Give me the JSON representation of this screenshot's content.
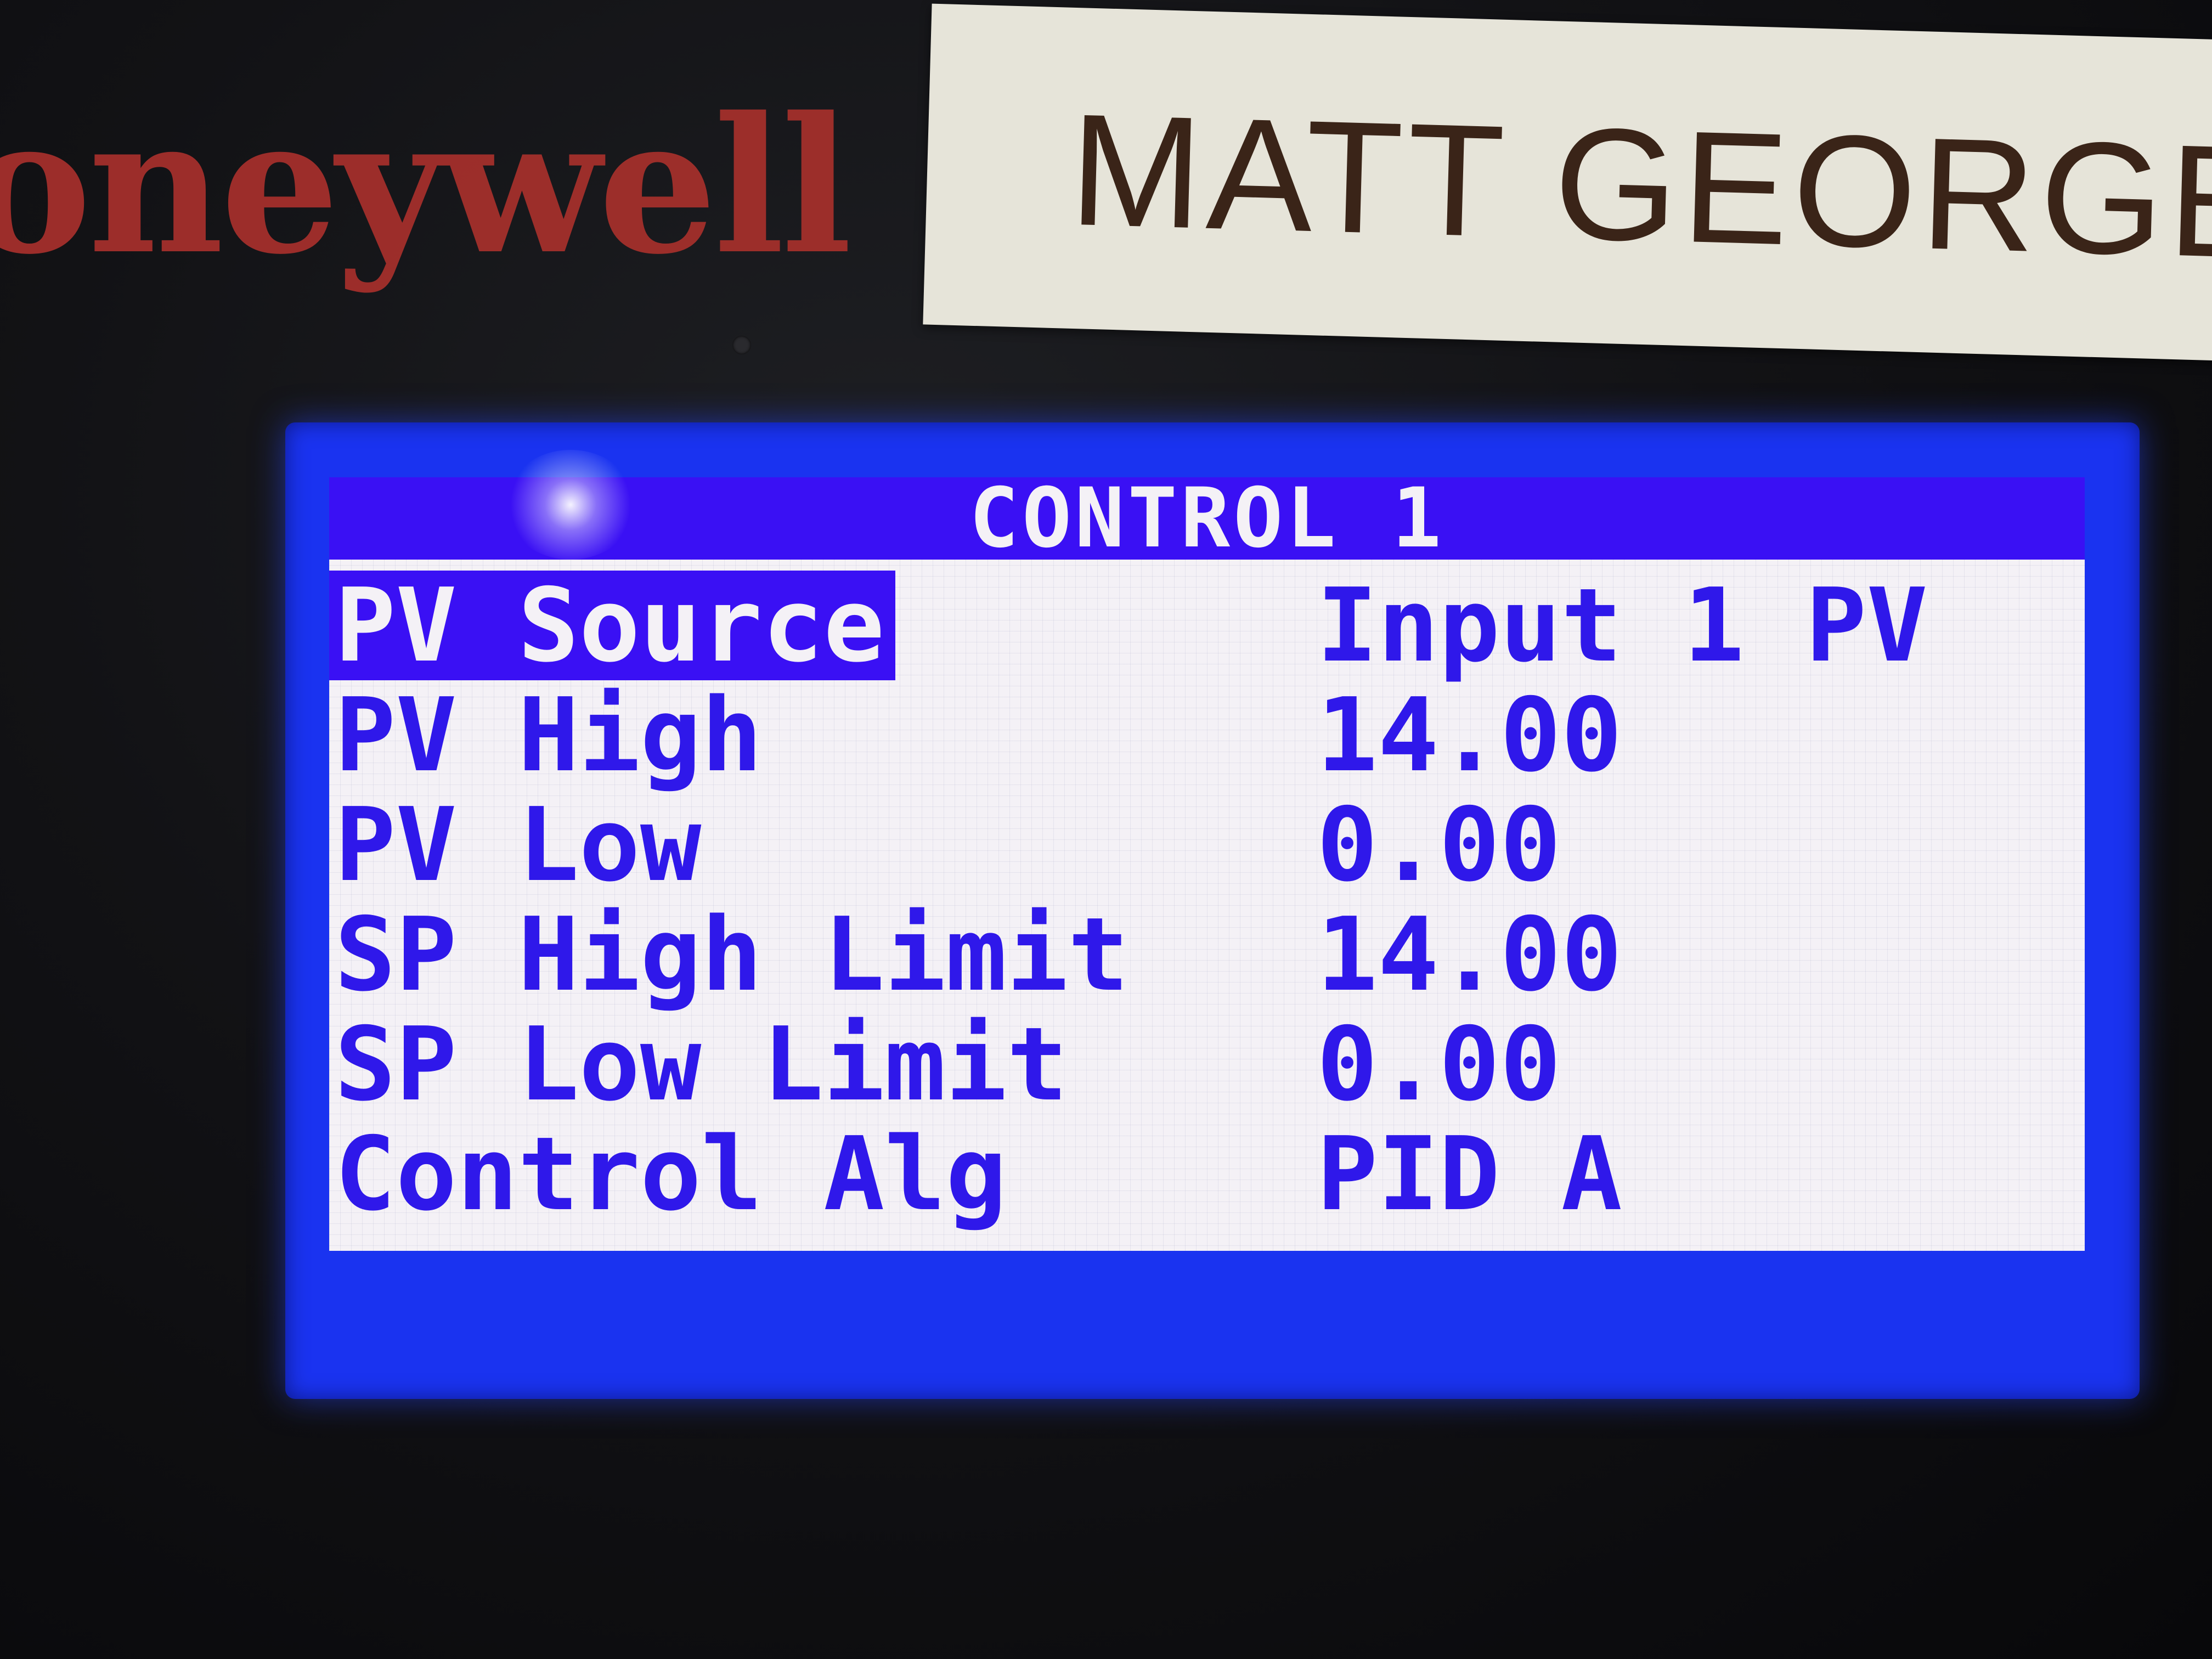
{
  "device": {
    "brand": "oneywell",
    "name_label": "MATT GEORGE"
  },
  "screen": {
    "title": "CONTROL 1",
    "rows": [
      {
        "label": "PV Source",
        "value": "Input 1 PV",
        "selected": true
      },
      {
        "label": "PV High",
        "value": "14.00",
        "selected": false
      },
      {
        "label": "PV Low",
        "value": "0.00",
        "selected": false
      },
      {
        "label": "SP High Limit",
        "value": "14.00",
        "selected": false
      },
      {
        "label": "SP Low Limit",
        "value": "0.00",
        "selected": false
      },
      {
        "label": "Control Alg",
        "value": "PID A",
        "selected": false
      }
    ]
  },
  "colors": {
    "lcd_text": "#2f18ea",
    "lcd_highlight": "#3a10f4",
    "lcd_background": "#f4f1f6",
    "bezel": "#1a33f0",
    "brand": "#a8302c",
    "label_paper": "#e6e4d9"
  }
}
